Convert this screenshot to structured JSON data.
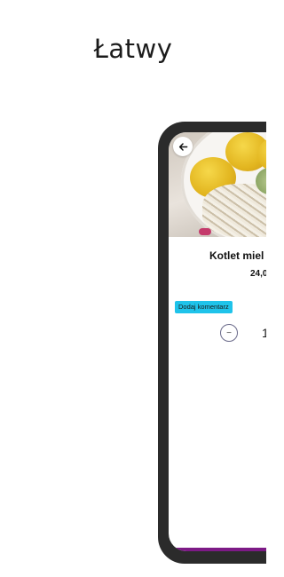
{
  "promo": {
    "headline": "Łatwy"
  },
  "product": {
    "name": "Kotlet miel",
    "price": "24,0",
    "photo_icon": "food-photo"
  },
  "actions": {
    "back_icon": "arrow-left-icon",
    "add_comment_label": "Dodaj komentarz",
    "decrease_label": "−",
    "quantity": "1"
  },
  "colors": {
    "accent": "#1fc3ea",
    "phone_frame": "#2b2b2b",
    "bottom_bar": "#7d1a86"
  }
}
